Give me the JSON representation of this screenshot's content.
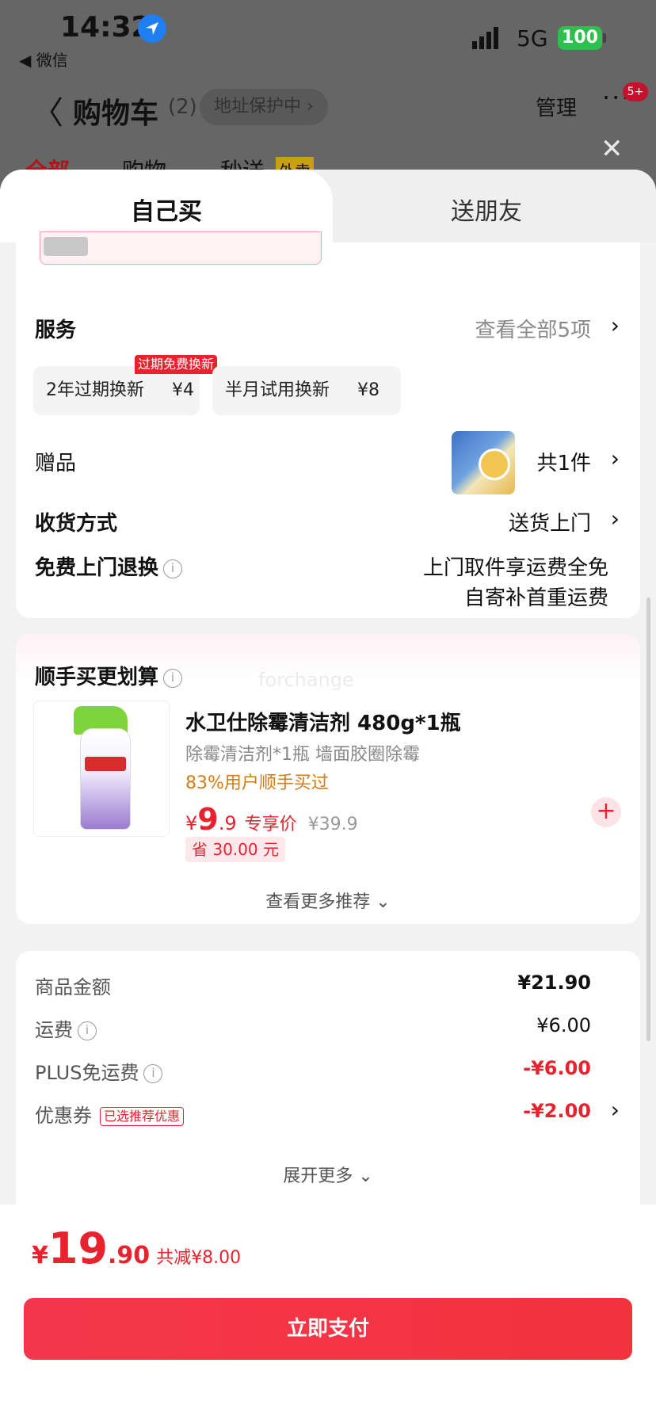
{
  "status_bar": {
    "time": "14:32",
    "back_app": "◀ 微信",
    "network": "5G",
    "battery": "100"
  },
  "nav": {
    "back": "〈",
    "title": "购物车",
    "count": "(2)",
    "addr_protect": "地址保护中 ›",
    "manage": "管理",
    "more": "···",
    "badge": "5+"
  },
  "bg_tabs": [
    "全部",
    "购物",
    "秒送",
    "外卖"
  ],
  "sheet_tabs": {
    "self": "自己买",
    "friend": "送朋友"
  },
  "services": {
    "label": "服务",
    "view_all": "查看全部5项",
    "items": [
      {
        "name": "2年过期换新",
        "price": "¥4",
        "tag": "过期免费换新"
      },
      {
        "name": "半月试用换新",
        "price": "¥8"
      }
    ]
  },
  "gift": {
    "label": "赠品",
    "count": "共1件"
  },
  "delivery": {
    "label": "收货方式",
    "value": "送货上门"
  },
  "free_return": {
    "label": "免费上门退换",
    "line1": "上门取件享运费全免",
    "line2": "自寄补首重运费"
  },
  "recommend": {
    "title": "顺手买更划算",
    "watermark": "forchange",
    "product": {
      "name": "水卫仕除霉清洁剂 480g*1瓶",
      "desc": "除霉清洁剂*1瓶 墙面胶圈除霉",
      "buy_rate": "83%用户顺手买过",
      "currency": "¥",
      "price_int": "9",
      "price_dec": ".9",
      "exclusive": "专享价",
      "original": "¥39.9",
      "save": "省 30.00 元"
    },
    "see_more": "查看更多推荐 ⌄"
  },
  "summary": {
    "goods_label": "商品金额",
    "goods_value": "¥21.90",
    "shipping_label": "运费",
    "shipping_value": "¥6.00",
    "plus_label": "PLUS免运费",
    "plus_value": "-¥6.00",
    "coupon_label": "优惠券",
    "coupon_tag": "已选推荐优惠",
    "coupon_value": "-¥2.00",
    "expand": "展开更多 ⌄"
  },
  "footer": {
    "currency": "¥",
    "total_int": "19",
    "total_dec": ".90",
    "discount": "共减¥8.00",
    "pay": "立即支付"
  },
  "colors": {
    "accent_red": "#e8232e",
    "orange": "#d57c16",
    "battery_green": "#2fbf4e"
  }
}
